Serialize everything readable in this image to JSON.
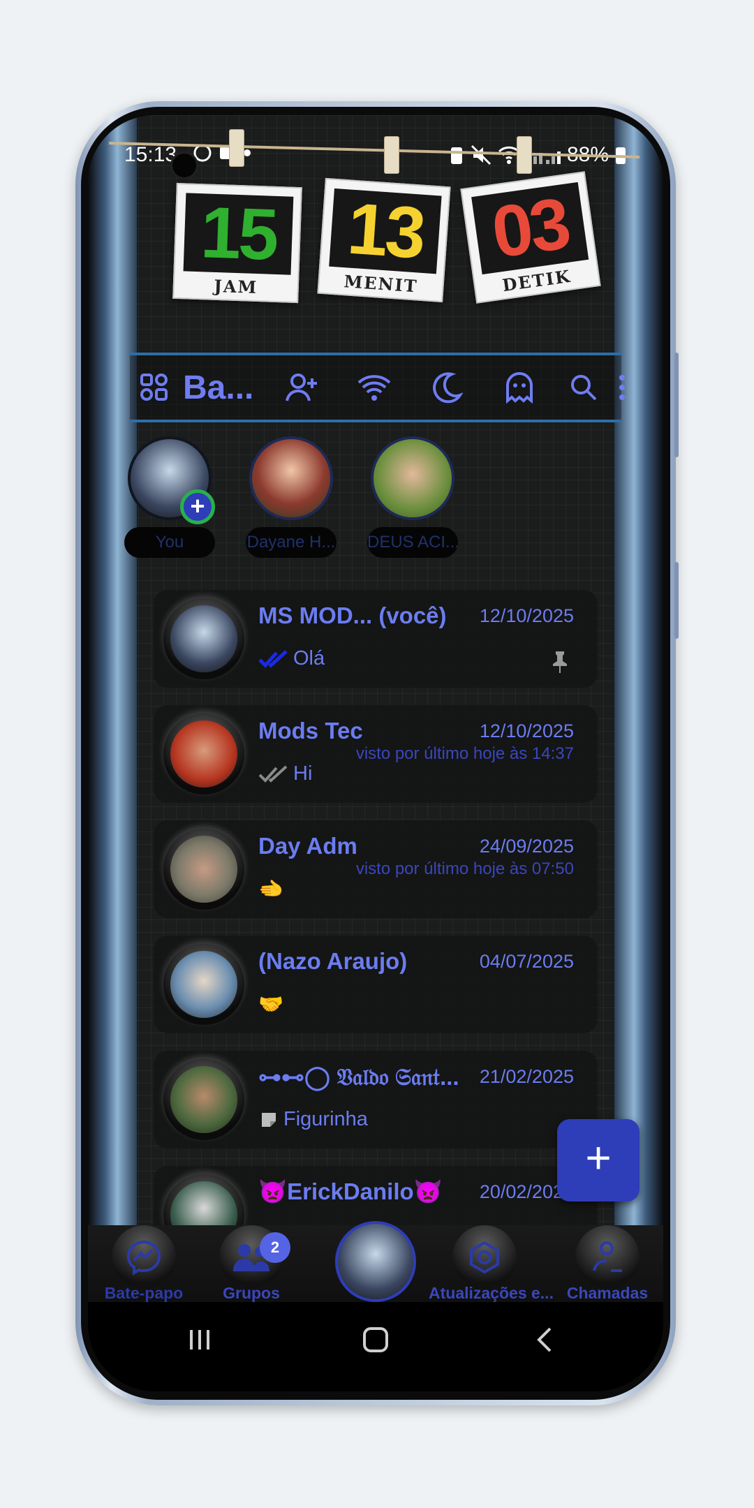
{
  "status_bar": {
    "time": "15:13",
    "battery": "88%"
  },
  "clock": {
    "hours": "15",
    "hours_label": "JAM",
    "hours_color": "#2fb02f",
    "minutes": "13",
    "minutes_label": "MENIT",
    "minutes_color": "#f5d230",
    "seconds": "03",
    "seconds_label": "DETIK",
    "seconds_color": "#e84a3a"
  },
  "toolbar": {
    "title": "Ba...",
    "icons": [
      "apps-grid-icon",
      "add-contact-icon",
      "wifi-icon",
      "moon-icon",
      "ghost-icon",
      "search-icon",
      "more-vertical-icon"
    ]
  },
  "stories": [
    {
      "name": "You"
    },
    {
      "name": "Dayane H..."
    },
    {
      "name": "DEUS ACI..."
    }
  ],
  "chats": [
    {
      "name": "MS MOD... (você)",
      "date": "12/10/2025",
      "subtitle": "",
      "message": "Olá",
      "tick": "double-blue",
      "pinned": true
    },
    {
      "name": "Mods Tec",
      "date": "12/10/2025",
      "subtitle": "visto por último hoje às 14:37",
      "message": "Hi",
      "tick": "double-gray",
      "pinned": false
    },
    {
      "name": "Day Adm",
      "date": "24/09/2025",
      "subtitle": "visto por último hoje às 07:50",
      "message": "🫲",
      "tick": "",
      "pinned": false
    },
    {
      "name": "(Nazo Araujo)",
      "date": "04/07/2025",
      "subtitle": "",
      "message": "🤝",
      "tick": "",
      "pinned": false
    },
    {
      "name": "⊶⊷◯ 𝔙𝔞𝔩𝔡𝔬 𝔖𝔞𝔫𝔱...",
      "date": "21/02/2025",
      "subtitle": "",
      "message": "Figurinha",
      "tick": "sticker",
      "pinned": false
    },
    {
      "name": "👿ErickDanilo👿",
      "date": "20/02/2025",
      "subtitle": "",
      "message": "",
      "tick": "",
      "pinned": false
    }
  ],
  "bottom_nav": [
    {
      "label": "Bate-papo",
      "icon": "messenger-icon",
      "badge": ""
    },
    {
      "label": "Grupos",
      "icon": "groups-icon",
      "badge": "2"
    },
    {
      "label": "",
      "icon": "profile-avatar",
      "badge": ""
    },
    {
      "label": "Atualizações e...",
      "icon": "updates-icon",
      "badge": ""
    },
    {
      "label": "Chamadas",
      "icon": "calls-icon",
      "badge": ""
    }
  ],
  "colors": {
    "accent": "#6b7df2",
    "accent_dark": "#2e3db8",
    "subtitle": "#3a47bd"
  }
}
